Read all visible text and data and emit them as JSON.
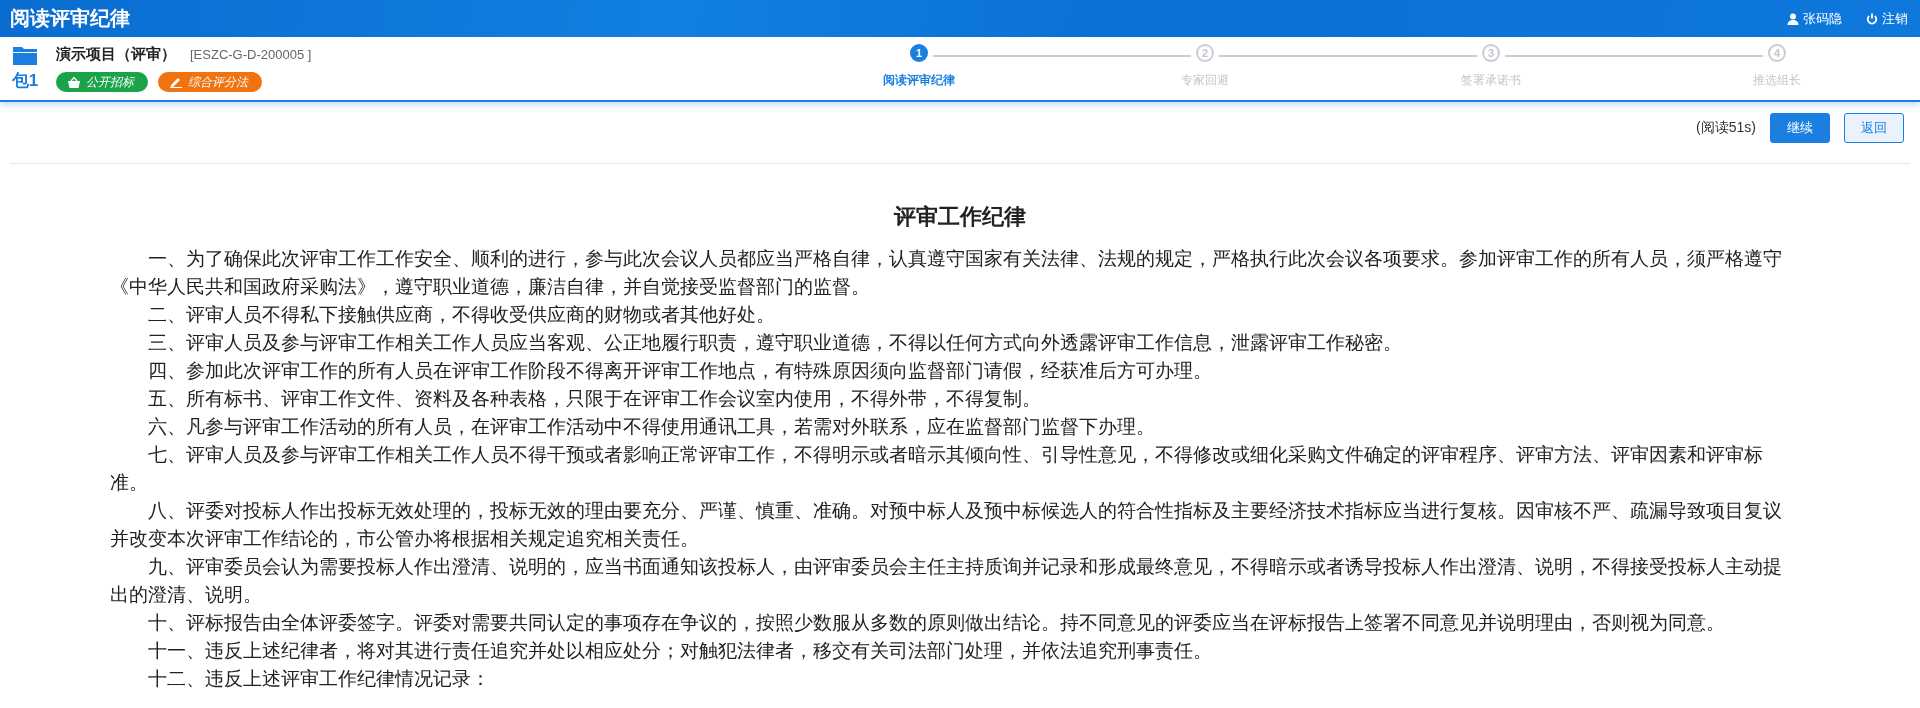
{
  "window": {
    "title": "阅读评审纪律"
  },
  "user": {
    "name": "张码隐",
    "logout": "注销"
  },
  "project": {
    "name": "演示项目（评审）",
    "code": "[ESZC-G-D-200005 ]",
    "package": "包1",
    "tags": [
      {
        "label": "公开招标",
        "color": "#1aa34a",
        "kind": "basket"
      },
      {
        "label": "综合评分法",
        "color": "#f0730f",
        "kind": "pencil"
      }
    ]
  },
  "steps": [
    {
      "number": "1",
      "label": "阅读评审纪律",
      "selected": true
    },
    {
      "number": "2",
      "label": "专家回避",
      "selected": false
    },
    {
      "number": "3",
      "label": "签署承诺书",
      "selected": false
    },
    {
      "number": "4",
      "label": "推选组长",
      "selected": false
    }
  ],
  "actions": {
    "timer": "(阅读51s)",
    "buttons": [
      {
        "label": "继续",
        "kind": "primary"
      },
      {
        "label": "返回",
        "kind": "secondary"
      }
    ]
  },
  "document": {
    "title": "评审工作纪律",
    "paragraphs": [
      "一、为了确保此次评审工作工作安全、顺利的进行，参与此次会议人员都应当严格自律，认真遵守国家有关法律、法规的规定，严格执行此次会议各项要求。参加评审工作的所有人员，须严格遵守《中华人民共和国政府采购法》，遵守职业道德，廉洁自律，并自觉接受监督部门的监督。",
      "二、评审人员不得私下接触供应商，不得收受供应商的财物或者其他好处。",
      "三、评审人员及参与评审工作相关工作人员应当客观、公正地履行职责，遵守职业道德，不得以任何方式向外透露评审工作信息，泄露评审工作秘密。",
      "四、参加此次评审工作的所有人员在评审工作阶段不得离开评审工作地点，有特殊原因须向监督部门请假，经获准后方可办理。",
      "五、所有标书、评审工作文件、资料及各种表格，只限于在评审工作会议室内使用，不得外带，不得复制。",
      "六、凡参与评审工作活动的所有人员，在评审工作活动中不得使用通讯工具，若需对外联系，应在监督部门监督下办理。",
      "七、评审人员及参与评审工作相关工作人员不得干预或者影响正常评审工作，不得明示或者暗示其倾向性、引导性意见，不得修改或细化采购文件确定的评审程序、评审方法、评审因素和评审标准。",
      "八、评委对投标人作出投标无效处理的，投标无效的理由要充分、严谨、慎重、准确。对预中标人及预中标候选人的符合性指标及主要经济技术指标应当进行复核。因审核不严、疏漏导致项目复议并改变本次评审工作结论的，市公管办将根据相关规定追究相关责任。",
      "九、评审委员会认为需要投标人作出澄清、说明的，应当书面通知该投标人，由评审委员会主任主持质询并记录和形成最终意见，不得暗示或者诱导投标人作出澄清、说明，不得接受投标人主动提出的澄清、说明。",
      "十、评标报告由全体评委签字。评委对需要共同认定的事项存在争议的，按照少数服从多数的原则做出结论。持不同意见的评委应当在评标报告上签署不同意见并说明理由，否则视为同意。",
      "十一、违反上述纪律者，将对其进行责任追究并处以相应处分；对触犯法律者，移交有关司法部门处理，并依法追究刑事责任。",
      "十二、违反上述评审工作纪律情况记录："
    ]
  }
}
